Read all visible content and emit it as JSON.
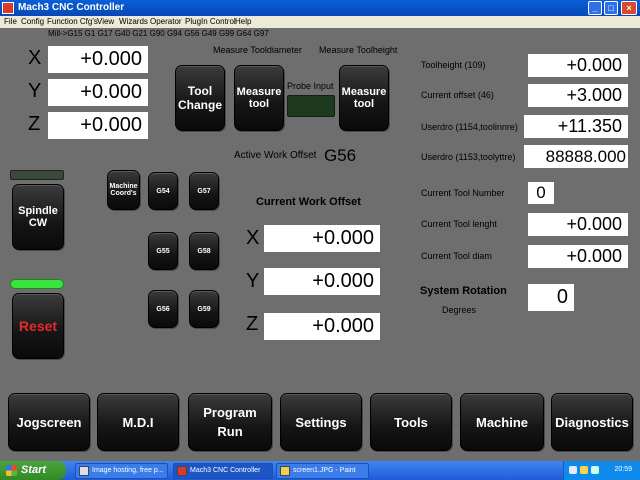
{
  "window": {
    "title": "Mach3 CNC Controller",
    "minimize": "_",
    "maximize": "□",
    "close": "×"
  },
  "menu": [
    "File",
    "Config",
    "Function Cfg's",
    "View",
    "Wizards",
    "Operator",
    "PlugIn Control",
    "Help"
  ],
  "gcode_line": "Mill->G15  G1 G17 G40 G21 G90 G94 G56 G49 G99 G64 G97",
  "axes": [
    {
      "axis": "X",
      "value": "+0.000"
    },
    {
      "axis": "Y",
      "value": "+0.000"
    },
    {
      "axis": "Z",
      "value": "+0.000"
    }
  ],
  "measure_tooldiameter_label": "Measure Tooldiameter",
  "measure_toolheight_label": "Measure Toolheight",
  "probe_input_label": "Probe Input",
  "buttons": {
    "tool_change": [
      "Tool",
      "Change"
    ],
    "measure_tool_1": [
      "Measure",
      "tool"
    ],
    "measure_tool_2": [
      "Measure",
      "tool"
    ],
    "spindle": [
      "Spindle",
      "CW"
    ],
    "reset": "Reset",
    "machine_coords": [
      "Machine",
      "Coord's"
    ],
    "g54": "G54",
    "g55": "G55",
    "g56": "G56",
    "g57": "G57",
    "g58": "G58",
    "g59": "G59"
  },
  "active_work_offset": {
    "label": "Active Work Offset",
    "value": "G56"
  },
  "current_work_offset": {
    "title": "Current Work Offset",
    "rows": [
      {
        "axis": "X",
        "value": "+0.000"
      },
      {
        "axis": "Y",
        "value": "+0.000"
      },
      {
        "axis": "Z",
        "value": "+0.000"
      }
    ]
  },
  "right_panel": [
    {
      "label": "Toolheight (109)",
      "value": "+0.000"
    },
    {
      "label": "Current offset (46)",
      "value": "+3.000"
    },
    {
      "label": "Userdro (1154,toolinnre)",
      "value": "+11.350"
    },
    {
      "label": "Userdro (1153,toolyttre)",
      "value": "88888.000"
    }
  ],
  "tool_info": {
    "number_label": "Current Tool Number",
    "number_value": "0",
    "length_label": "Current Tool lenght",
    "length_value": "+0.000",
    "diam_label": "Current Tool diam",
    "diam_value": "+0.000"
  },
  "system_rotation": {
    "label": "System Rotation",
    "unit": "Degrees",
    "value": "0"
  },
  "bottom_tabs": [
    "Jogscreen",
    "M.D.I",
    "Program Run",
    "Settings",
    "Tools",
    "Machine",
    "Diagnostics"
  ],
  "taskbar": {
    "start": "Start",
    "tasks": [
      "Image hosting, free p...",
      "Mach3 CNC Controller",
      "screen1.JPG - Paint"
    ],
    "clock": "20:59"
  },
  "colors": {
    "background": "#6e6e6e",
    "spindle_led": "#3a4a3a",
    "reset_led": "#39e23c",
    "probe_led": "#1e3a1e",
    "reset_text": "#e8292c"
  }
}
